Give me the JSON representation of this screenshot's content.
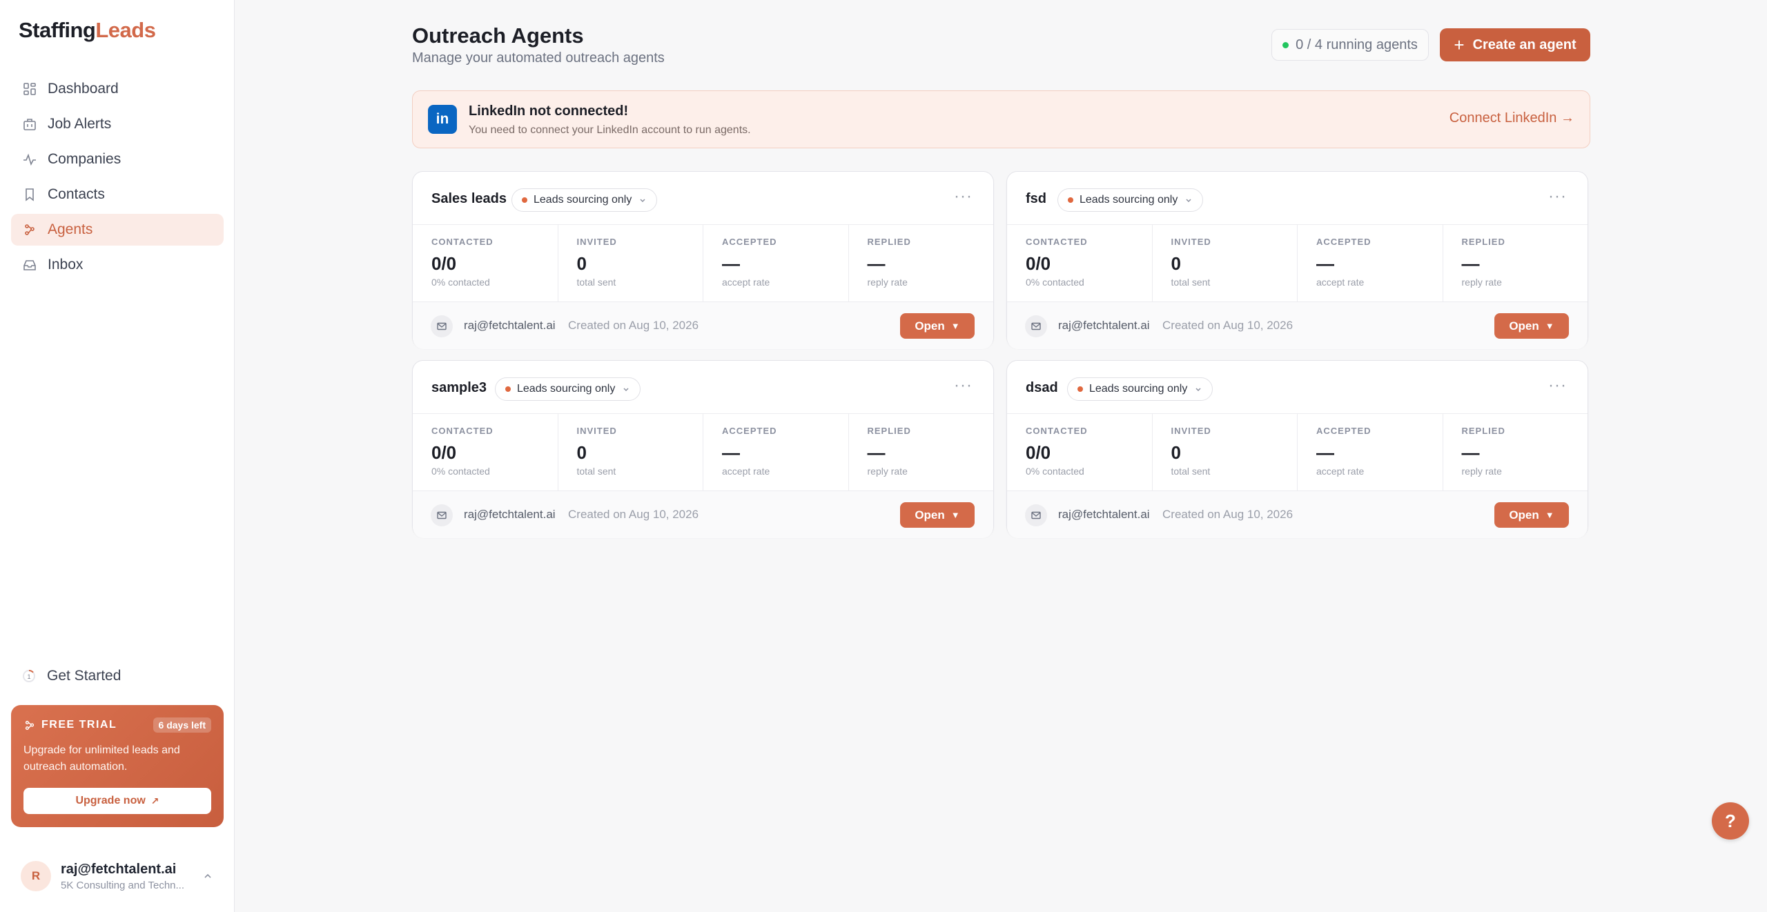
{
  "brand": {
    "part1": "Staffing",
    "part2": "Leads"
  },
  "nav": [
    {
      "label": "Dashboard",
      "icon": "dashboard-icon"
    },
    {
      "label": "Job Alerts",
      "icon": "briefcase-icon"
    },
    {
      "label": "Companies",
      "icon": "activity-icon"
    },
    {
      "label": "Contacts",
      "icon": "bookmark-icon"
    },
    {
      "label": "Agents",
      "icon": "agents-icon",
      "active": true
    },
    {
      "label": "Inbox",
      "icon": "inbox-icon"
    }
  ],
  "get_started": {
    "label": "Get Started",
    "step": "1"
  },
  "trial": {
    "title": "FREE TRIAL",
    "badge": "6 days left",
    "text": "Upgrade for unlimited leads and outreach automation.",
    "button": "Upgrade now",
    "button_icon": "↗"
  },
  "user": {
    "initial": "R",
    "email": "raj@fetchtalent.ai",
    "org": "5K Consulting and Techn..."
  },
  "header": {
    "title": "Outreach Agents",
    "subtitle": "Manage your automated outreach agents",
    "running": "0 / 4 running agents",
    "create_button": "Create an agent",
    "create_icon": "+"
  },
  "alert": {
    "icon_text": "in",
    "title": "LinkedIn not connected!",
    "subtitle": "You need to connect your LinkedIn account to run agents.",
    "link": "Connect LinkedIn →"
  },
  "stat_labels": {
    "contacted": "CONTACTED",
    "invited": "INVITED",
    "accepted": "ACCEPTED",
    "replied": "REPLIED"
  },
  "agents": [
    {
      "name": "Sales leads",
      "mode": "Leads sourcing only",
      "contacted": "0/0",
      "contacted_sub": "0% contacted",
      "invited": "0",
      "invited_sub": "total sent",
      "accepted": "—",
      "accepted_sub": "accept rate",
      "replied": "—",
      "replied_sub": "reply rate",
      "email": "raj@fetchtalent.ai",
      "created": "Created on Aug 10, 2026",
      "open": "Open"
    },
    {
      "name": "fsd",
      "mode": "Leads sourcing only",
      "contacted": "0/0",
      "contacted_sub": "0% contacted",
      "invited": "0",
      "invited_sub": "total sent",
      "accepted": "—",
      "accepted_sub": "accept rate",
      "replied": "—",
      "replied_sub": "reply rate",
      "email": "raj@fetchtalent.ai",
      "created": "Created on Aug 10, 2026",
      "open": "Open"
    },
    {
      "name": "sample3",
      "mode": "Leads sourcing only",
      "contacted": "0/0",
      "contacted_sub": "0% contacted",
      "invited": "0",
      "invited_sub": "total sent",
      "accepted": "—",
      "accepted_sub": "accept rate",
      "replied": "—",
      "replied_sub": "reply rate",
      "email": "raj@fetchtalent.ai",
      "created": "Created on Aug 10, 2026",
      "open": "Open"
    },
    {
      "name": "dsad",
      "mode": "Leads sourcing only",
      "contacted": "0/0",
      "contacted_sub": "0% contacted",
      "invited": "0",
      "invited_sub": "total sent",
      "accepted": "—",
      "accepted_sub": "accept rate",
      "replied": "—",
      "replied_sub": "reply rate",
      "email": "raj@fetchtalent.ai",
      "created": "Created on Aug 10, 2026",
      "open": "Open"
    }
  ],
  "help": "?",
  "colors": {
    "accent": "#c9603f",
    "status_running": "#22c55e",
    "linkedin": "#0a66c2"
  }
}
